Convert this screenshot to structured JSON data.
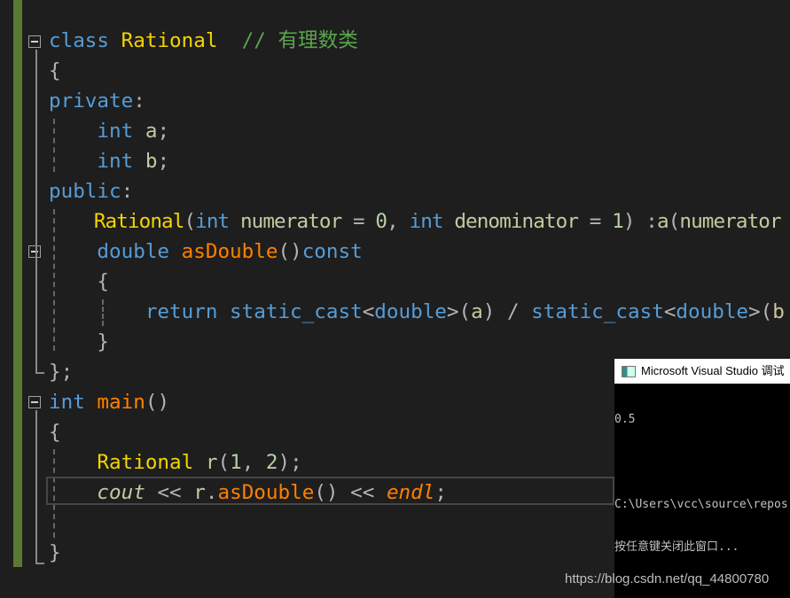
{
  "editor": {
    "lines": [
      [
        [
          "class ",
          "kw"
        ],
        [
          "Rational",
          "type"
        ],
        [
          "  // 有理数类",
          "cm"
        ]
      ],
      [
        [
          "{",
          "op"
        ]
      ],
      [
        [
          "private",
          "kw"
        ],
        [
          ":",
          "op"
        ]
      ],
      [
        [
          "    ",
          " "
        ],
        [
          "int ",
          "kw"
        ],
        [
          "a",
          "var"
        ],
        [
          ";",
          "op"
        ]
      ],
      [
        [
          "    ",
          " "
        ],
        [
          "int ",
          "kw"
        ],
        [
          "b",
          "var"
        ],
        [
          ";",
          "op"
        ]
      ],
      [
        [
          "public",
          "kw"
        ],
        [
          ":",
          "op"
        ]
      ],
      [
        [
          "    ",
          " "
        ],
        [
          "Rational",
          "type"
        ],
        [
          "(",
          "op"
        ],
        [
          "int ",
          "kw"
        ],
        [
          "numerator ",
          "var"
        ],
        [
          "= ",
          "op"
        ],
        [
          "0",
          "num"
        ],
        [
          ", ",
          "op"
        ],
        [
          "int ",
          "kw"
        ],
        [
          "denominator ",
          "var"
        ],
        [
          "= ",
          "op"
        ],
        [
          "1",
          "num"
        ],
        [
          ") :",
          "op"
        ],
        [
          "a",
          "var"
        ],
        [
          "(",
          "op"
        ],
        [
          "numerator",
          "var"
        ]
      ],
      [
        [
          "    ",
          " "
        ],
        [
          "double ",
          "kw"
        ],
        [
          "asDouble",
          "fn"
        ],
        [
          "()",
          "op"
        ],
        [
          "const",
          "kw"
        ]
      ],
      [
        [
          "    {",
          "op"
        ]
      ],
      [
        [
          "        ",
          " "
        ],
        [
          "return ",
          "kw"
        ],
        [
          "static_cast",
          "kw"
        ],
        [
          "<",
          "op"
        ],
        [
          "double",
          "kw"
        ],
        [
          ">(",
          "op"
        ],
        [
          "a",
          "var"
        ],
        [
          ") / ",
          "op"
        ],
        [
          "static_cast",
          "kw"
        ],
        [
          "<",
          "op"
        ],
        [
          "double",
          "kw"
        ],
        [
          ">(",
          "op"
        ],
        [
          "b",
          "var"
        ]
      ],
      [
        [
          "    }",
          "op"
        ]
      ],
      [
        [
          "};",
          "op"
        ]
      ],
      [
        [
          "int ",
          "kw"
        ],
        [
          "main",
          "fn"
        ],
        [
          "()",
          "op"
        ]
      ],
      [
        [
          "{",
          "op"
        ]
      ],
      [
        [
          "    ",
          " "
        ],
        [
          "Rational ",
          "type"
        ],
        [
          "r",
          "var"
        ],
        [
          "(",
          "op"
        ],
        [
          "1",
          "num"
        ],
        [
          ", ",
          "op"
        ],
        [
          "2",
          "num"
        ],
        [
          ");",
          "op"
        ]
      ],
      [
        [
          "    ",
          " "
        ],
        [
          "cout",
          "it-var"
        ],
        [
          " << ",
          "op"
        ],
        [
          "r",
          "var"
        ],
        [
          ".",
          "op"
        ],
        [
          "asDouble",
          "fn"
        ],
        [
          "() << ",
          "op"
        ],
        [
          "endl",
          "it-fn"
        ],
        [
          ";",
          "op"
        ]
      ],
      [
        [
          "",
          ""
        ]
      ],
      [
        [
          "}",
          "op"
        ]
      ]
    ]
  },
  "console": {
    "title": "Microsoft Visual Studio 调试控制台",
    "output": [
      "0.5",
      "",
      "C:\\Users\\vcc\\source\\repos",
      "按任意键关闭此窗口..."
    ]
  },
  "watermark": "https://blog.csdn.net/qq_44800780"
}
